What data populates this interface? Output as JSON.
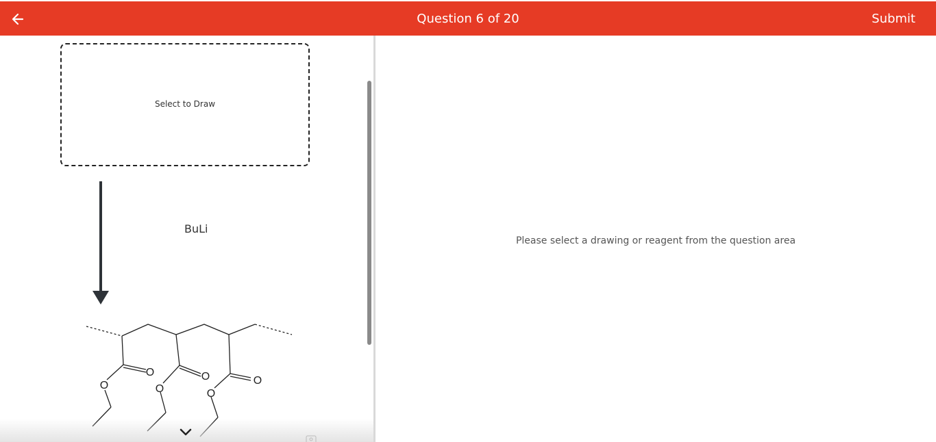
{
  "header": {
    "title": "Question 6 of 20",
    "submit_label": "Submit",
    "back_icon": "arrow-left-icon",
    "bar_color": "#e63b25"
  },
  "question": {
    "draw_box_label": "Select to Draw",
    "reagent": "BuLi",
    "molecule_atoms": [
      "O",
      "O",
      "O",
      "O",
      "O",
      "O"
    ]
  },
  "right_pane": {
    "placeholder": "Please select a drawing or reagent from the question area"
  },
  "icons": {
    "scroll_down": "chevron-down-icon"
  }
}
